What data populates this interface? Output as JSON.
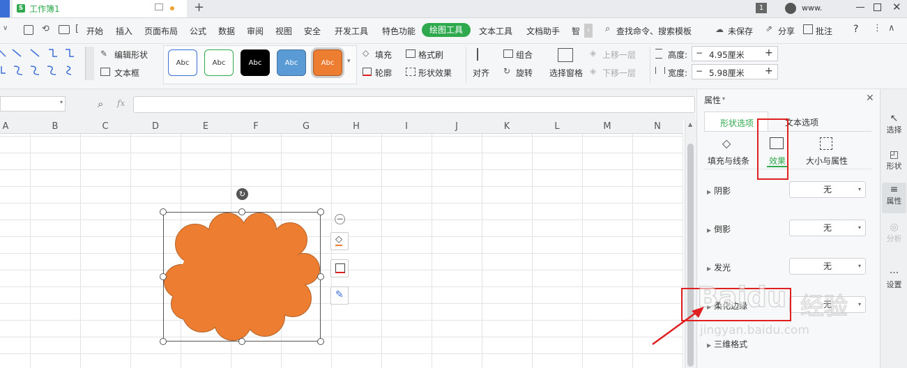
{
  "titlebar": {
    "doc_title": "工作簿1",
    "new_tab": "+",
    "page_badge": "1",
    "user": "www.",
    "app_badge": "S"
  },
  "menubar": {
    "items": [
      "开始",
      "插入",
      "页面布局",
      "公式",
      "数据",
      "审阅",
      "视图",
      "安全",
      "开发工具",
      "特色功能",
      "绘图工具",
      "文本工具",
      "文档助手",
      "智"
    ],
    "active": "绘图工具",
    "search": "查找命令、搜索模板",
    "unsaved": "未保存",
    "share": "分享",
    "annotate": "批注",
    "help": "?"
  },
  "ribbon": {
    "edit_shape": "编辑形状",
    "text_box": "文本框",
    "style_label": "Abc",
    "fill": "填充",
    "format_brush": "格式刷",
    "outline": "轮廓",
    "shape_effect": "形状效果",
    "align": "对齐",
    "group": "组合",
    "rotate": "旋转",
    "select_pane": "选择窗格",
    "bring_forward": "上移一层",
    "send_backward": "下移一层",
    "height_label": "高度:",
    "height_value": "4.95厘米",
    "width_label": "宽度:",
    "width_value": "5.98厘米",
    "minus": "−",
    "plus": "+"
  },
  "formulabar": {
    "fx": "fx"
  },
  "columns": [
    "A",
    "B",
    "C",
    "D",
    "E",
    "F",
    "G",
    "H",
    "I",
    "J",
    "K",
    "L",
    "M",
    "N"
  ],
  "shape": {
    "fill": "#ed7d31",
    "stroke": "#b5652a"
  },
  "pane": {
    "title": "属性",
    "tab_shape": "形状选项",
    "tab_text": "文本选项",
    "sub_fill_line": "填充与线条",
    "sub_effect": "效果",
    "sub_size": "大小与属性",
    "rows": [
      {
        "label": "阴影",
        "value": "无"
      },
      {
        "label": "倒影",
        "value": "无"
      },
      {
        "label": "发光",
        "value": "无"
      },
      {
        "label": "柔化边缘",
        "value": "无"
      },
      {
        "label": "三维格式",
        "value": ""
      }
    ]
  },
  "rightbar": {
    "select": "选择",
    "shape": "形状",
    "property": "属性",
    "analyze": "分析",
    "settings": "设置"
  },
  "watermark": {
    "brand": "Baidu",
    "jingyan": "经验",
    "url": "jingyan.baidu.com"
  },
  "colors": {
    "accent": "#2fa94e",
    "annotation": "#e02020"
  }
}
